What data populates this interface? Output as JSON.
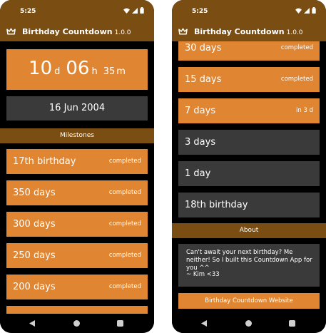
{
  "status": {
    "time": "5:25"
  },
  "app": {
    "title": "Birthday Countdown",
    "version": "1.0.0"
  },
  "countdown": {
    "days": "10",
    "days_unit": "d",
    "hours": "06",
    "hours_unit": "h",
    "minutes": "35",
    "minutes_unit": "m"
  },
  "birthdate": "16 Jun 2004",
  "sections": {
    "milestones": "Milestones",
    "about": "About"
  },
  "milestones_left": [
    {
      "label": "17th birthday",
      "status": "completed"
    },
    {
      "label": "350 days",
      "status": "completed"
    },
    {
      "label": "300 days",
      "status": "completed"
    },
    {
      "label": "250 days",
      "status": "completed"
    },
    {
      "label": "200 days",
      "status": "completed"
    }
  ],
  "milestones_right": [
    {
      "label": "30 days",
      "status": "completed"
    },
    {
      "label": "15 days",
      "status": "completed"
    },
    {
      "label": "7 days",
      "status": "in 3 d"
    },
    {
      "label": "3 days",
      "status": ""
    },
    {
      "label": "1 day",
      "status": ""
    },
    {
      "label": "18th birthday",
      "status": ""
    }
  ],
  "about": {
    "text": "Can't await your next birthday? Me neither! So I built this Countdown App for you ^^",
    "signature": "~ Kim <33"
  },
  "website_button": "Birthday Countdown Website",
  "colors": {
    "bar": "#7a4e12",
    "accent": "#e08532",
    "card": "#3a3a3a",
    "background": "#000000"
  },
  "icons": [
    "crown-icon",
    "wifi-icon",
    "signal-icon",
    "battery-icon",
    "back-icon",
    "home-icon",
    "recents-icon"
  ]
}
